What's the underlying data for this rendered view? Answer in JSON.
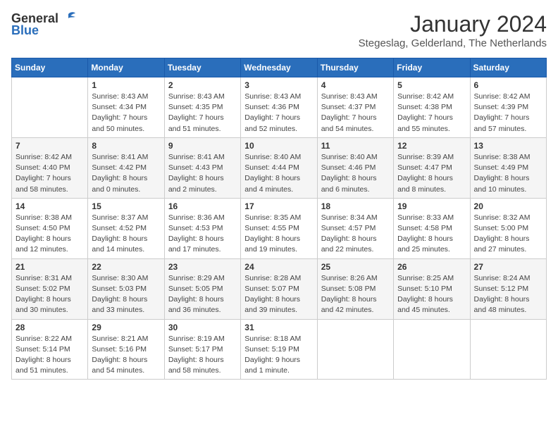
{
  "header": {
    "logo_general": "General",
    "logo_blue": "Blue",
    "month_title": "January 2024",
    "location": "Stegeslag, Gelderland, The Netherlands"
  },
  "days_of_week": [
    "Sunday",
    "Monday",
    "Tuesday",
    "Wednesday",
    "Thursday",
    "Friday",
    "Saturday"
  ],
  "weeks": [
    [
      {
        "day": "",
        "info": ""
      },
      {
        "day": "1",
        "info": "Sunrise: 8:43 AM\nSunset: 4:34 PM\nDaylight: 7 hours\nand 50 minutes."
      },
      {
        "day": "2",
        "info": "Sunrise: 8:43 AM\nSunset: 4:35 PM\nDaylight: 7 hours\nand 51 minutes."
      },
      {
        "day": "3",
        "info": "Sunrise: 8:43 AM\nSunset: 4:36 PM\nDaylight: 7 hours\nand 52 minutes."
      },
      {
        "day": "4",
        "info": "Sunrise: 8:43 AM\nSunset: 4:37 PM\nDaylight: 7 hours\nand 54 minutes."
      },
      {
        "day": "5",
        "info": "Sunrise: 8:42 AM\nSunset: 4:38 PM\nDaylight: 7 hours\nand 55 minutes."
      },
      {
        "day": "6",
        "info": "Sunrise: 8:42 AM\nSunset: 4:39 PM\nDaylight: 7 hours\nand 57 minutes."
      }
    ],
    [
      {
        "day": "7",
        "info": "Sunrise: 8:42 AM\nSunset: 4:40 PM\nDaylight: 7 hours\nand 58 minutes."
      },
      {
        "day": "8",
        "info": "Sunrise: 8:41 AM\nSunset: 4:42 PM\nDaylight: 8 hours\nand 0 minutes."
      },
      {
        "day": "9",
        "info": "Sunrise: 8:41 AM\nSunset: 4:43 PM\nDaylight: 8 hours\nand 2 minutes."
      },
      {
        "day": "10",
        "info": "Sunrise: 8:40 AM\nSunset: 4:44 PM\nDaylight: 8 hours\nand 4 minutes."
      },
      {
        "day": "11",
        "info": "Sunrise: 8:40 AM\nSunset: 4:46 PM\nDaylight: 8 hours\nand 6 minutes."
      },
      {
        "day": "12",
        "info": "Sunrise: 8:39 AM\nSunset: 4:47 PM\nDaylight: 8 hours\nand 8 minutes."
      },
      {
        "day": "13",
        "info": "Sunrise: 8:38 AM\nSunset: 4:49 PM\nDaylight: 8 hours\nand 10 minutes."
      }
    ],
    [
      {
        "day": "14",
        "info": "Sunrise: 8:38 AM\nSunset: 4:50 PM\nDaylight: 8 hours\nand 12 minutes."
      },
      {
        "day": "15",
        "info": "Sunrise: 8:37 AM\nSunset: 4:52 PM\nDaylight: 8 hours\nand 14 minutes."
      },
      {
        "day": "16",
        "info": "Sunrise: 8:36 AM\nSunset: 4:53 PM\nDaylight: 8 hours\nand 17 minutes."
      },
      {
        "day": "17",
        "info": "Sunrise: 8:35 AM\nSunset: 4:55 PM\nDaylight: 8 hours\nand 19 minutes."
      },
      {
        "day": "18",
        "info": "Sunrise: 8:34 AM\nSunset: 4:57 PM\nDaylight: 8 hours\nand 22 minutes."
      },
      {
        "day": "19",
        "info": "Sunrise: 8:33 AM\nSunset: 4:58 PM\nDaylight: 8 hours\nand 25 minutes."
      },
      {
        "day": "20",
        "info": "Sunrise: 8:32 AM\nSunset: 5:00 PM\nDaylight: 8 hours\nand 27 minutes."
      }
    ],
    [
      {
        "day": "21",
        "info": "Sunrise: 8:31 AM\nSunset: 5:02 PM\nDaylight: 8 hours\nand 30 minutes."
      },
      {
        "day": "22",
        "info": "Sunrise: 8:30 AM\nSunset: 5:03 PM\nDaylight: 8 hours\nand 33 minutes."
      },
      {
        "day": "23",
        "info": "Sunrise: 8:29 AM\nSunset: 5:05 PM\nDaylight: 8 hours\nand 36 minutes."
      },
      {
        "day": "24",
        "info": "Sunrise: 8:28 AM\nSunset: 5:07 PM\nDaylight: 8 hours\nand 39 minutes."
      },
      {
        "day": "25",
        "info": "Sunrise: 8:26 AM\nSunset: 5:08 PM\nDaylight: 8 hours\nand 42 minutes."
      },
      {
        "day": "26",
        "info": "Sunrise: 8:25 AM\nSunset: 5:10 PM\nDaylight: 8 hours\nand 45 minutes."
      },
      {
        "day": "27",
        "info": "Sunrise: 8:24 AM\nSunset: 5:12 PM\nDaylight: 8 hours\nand 48 minutes."
      }
    ],
    [
      {
        "day": "28",
        "info": "Sunrise: 8:22 AM\nSunset: 5:14 PM\nDaylight: 8 hours\nand 51 minutes."
      },
      {
        "day": "29",
        "info": "Sunrise: 8:21 AM\nSunset: 5:16 PM\nDaylight: 8 hours\nand 54 minutes."
      },
      {
        "day": "30",
        "info": "Sunrise: 8:19 AM\nSunset: 5:17 PM\nDaylight: 8 hours\nand 58 minutes."
      },
      {
        "day": "31",
        "info": "Sunrise: 8:18 AM\nSunset: 5:19 PM\nDaylight: 9 hours\nand 1 minute."
      },
      {
        "day": "",
        "info": ""
      },
      {
        "day": "",
        "info": ""
      },
      {
        "day": "",
        "info": ""
      }
    ]
  ]
}
